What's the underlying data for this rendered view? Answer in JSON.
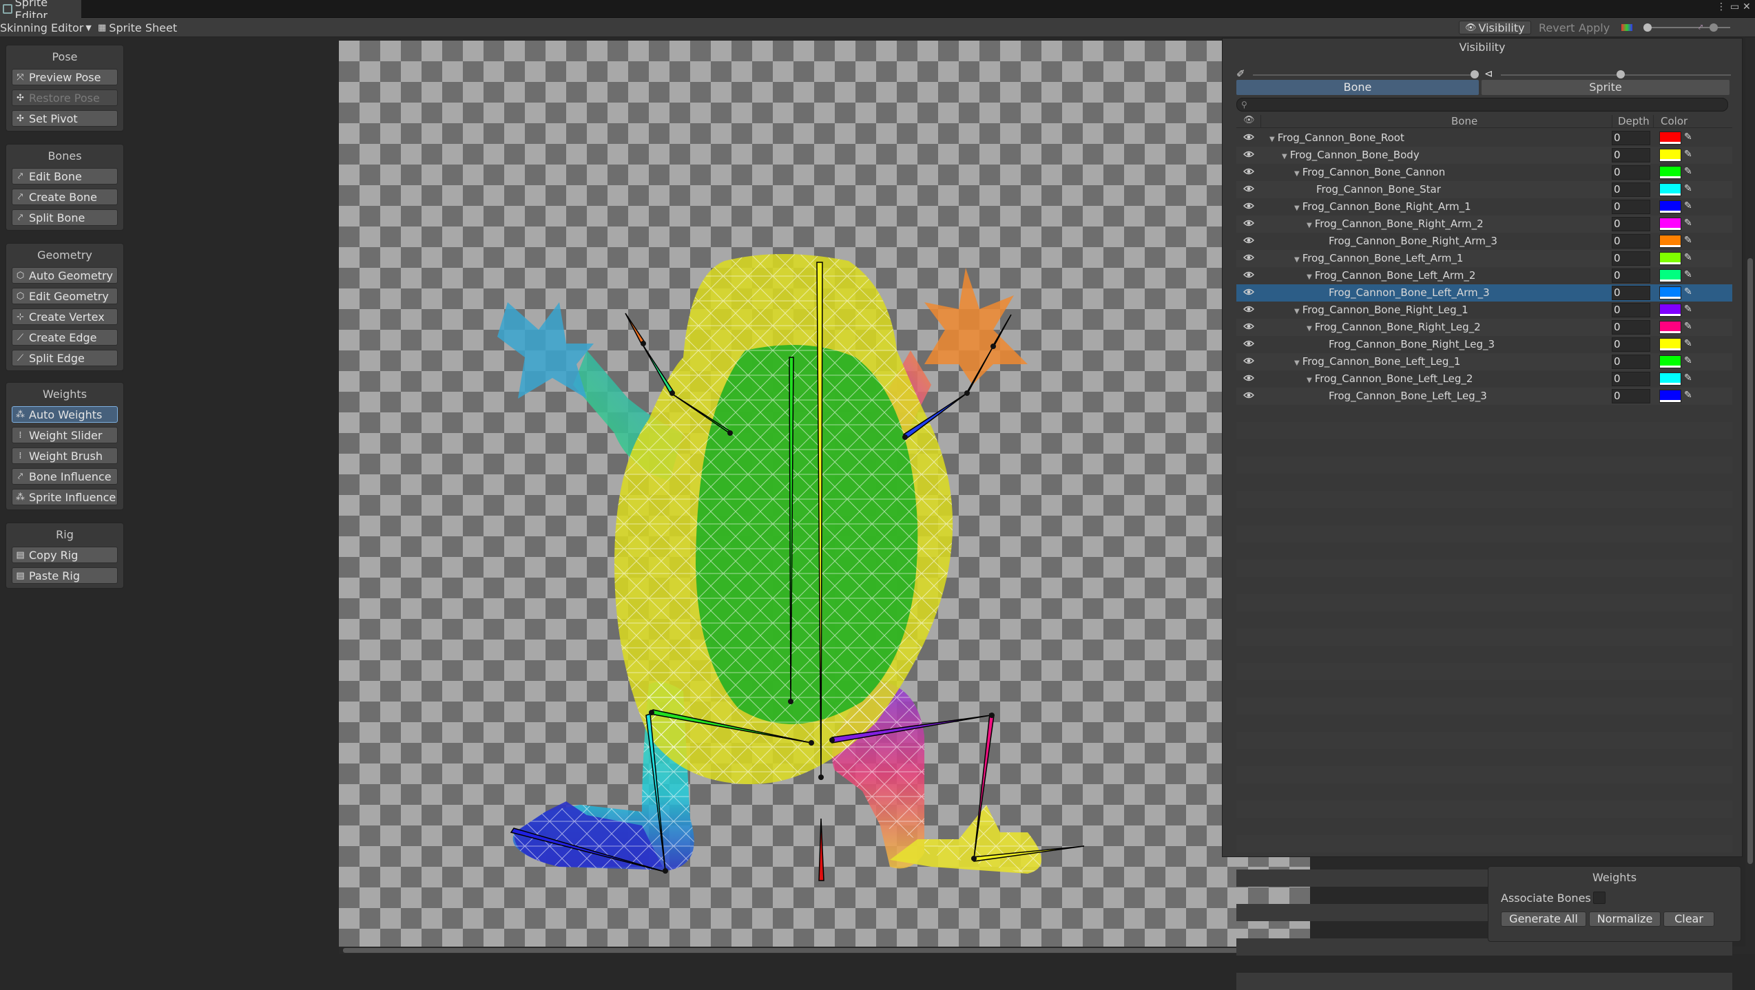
{
  "window": {
    "title": "Sprite Editor"
  },
  "toolbar": {
    "mode_dropdown": "Skinning Editor",
    "sprite_sheet": "Sprite Sheet",
    "visibility": "Visibility",
    "revert": "Revert",
    "apply": "Apply"
  },
  "left_panel": {
    "groups": [
      {
        "title": "Pose",
        "tools": [
          {
            "label": "Preview Pose",
            "state": "normal"
          },
          {
            "label": "Restore Pose",
            "state": "disabled"
          },
          {
            "label": "Set Pivot",
            "state": "normal"
          }
        ]
      },
      {
        "title": "Bones",
        "tools": [
          {
            "label": "Edit Bone",
            "state": "normal"
          },
          {
            "label": "Create Bone",
            "state": "normal"
          },
          {
            "label": "Split Bone",
            "state": "normal"
          }
        ]
      },
      {
        "title": "Geometry",
        "tools": [
          {
            "label": "Auto Geometry",
            "state": "normal"
          },
          {
            "label": "Edit Geometry",
            "state": "normal"
          },
          {
            "label": "Create Vertex",
            "state": "normal"
          },
          {
            "label": "Create Edge",
            "state": "normal"
          },
          {
            "label": "Split Edge",
            "state": "normal"
          }
        ]
      },
      {
        "title": "Weights",
        "tools": [
          {
            "label": "Auto Weights",
            "state": "active"
          },
          {
            "label": "Weight Slider",
            "state": "normal"
          },
          {
            "label": "Weight Brush",
            "state": "normal"
          },
          {
            "label": "Bone Influence",
            "state": "normal"
          },
          {
            "label": "Sprite Influence",
            "state": "normal"
          }
        ]
      },
      {
        "title": "Rig",
        "tools": [
          {
            "label": "Copy Rig",
            "state": "normal"
          },
          {
            "label": "Paste Rig",
            "state": "normal"
          }
        ]
      }
    ]
  },
  "visibility_panel": {
    "title": "Visibility",
    "tabs": {
      "bone": "Bone",
      "sprite": "Sprite"
    },
    "columns": {
      "bone": "Bone",
      "depth": "Depth",
      "color": "Color"
    },
    "bones": [
      {
        "name": "Frog_Cannon_Bone_Root",
        "indent": 0,
        "arrow": true,
        "depth": "0",
        "color": "#ff0000",
        "selected": false
      },
      {
        "name": "Frog_Cannon_Bone_Body",
        "indent": 1,
        "arrow": true,
        "depth": "0",
        "color": "#ffff00",
        "selected": false
      },
      {
        "name": "Frog_Cannon_Bone_Cannon",
        "indent": 2,
        "arrow": true,
        "depth": "0",
        "color": "#00ff00",
        "selected": false
      },
      {
        "name": "Frog_Cannon_Bone_Star",
        "indent": 3,
        "arrow": false,
        "depth": "0",
        "color": "#00ffff",
        "selected": false
      },
      {
        "name": "Frog_Cannon_Bone_Right_Arm_1",
        "indent": 2,
        "arrow": true,
        "depth": "0",
        "color": "#0000ff",
        "selected": false
      },
      {
        "name": "Frog_Cannon_Bone_Right_Arm_2",
        "indent": 3,
        "arrow": true,
        "depth": "0",
        "color": "#ff00ff",
        "selected": false
      },
      {
        "name": "Frog_Cannon_Bone_Right_Arm_3",
        "indent": 4,
        "arrow": false,
        "depth": "0",
        "color": "#ff8000",
        "selected": false
      },
      {
        "name": "Frog_Cannon_Bone_Left_Arm_1",
        "indent": 2,
        "arrow": true,
        "depth": "0",
        "color": "#80ff00",
        "selected": false
      },
      {
        "name": "Frog_Cannon_Bone_Left_Arm_2",
        "indent": 3,
        "arrow": true,
        "depth": "0",
        "color": "#00ff80",
        "selected": false
      },
      {
        "name": "Frog_Cannon_Bone_Left_Arm_3",
        "indent": 4,
        "arrow": false,
        "depth": "0",
        "color": "#0080ff",
        "selected": true
      },
      {
        "name": "Frog_Cannon_Bone_Right_Leg_1",
        "indent": 2,
        "arrow": true,
        "depth": "0",
        "color": "#8000ff",
        "selected": false
      },
      {
        "name": "Frog_Cannon_Bone_Right_Leg_2",
        "indent": 3,
        "arrow": true,
        "depth": "0",
        "color": "#ff0080",
        "selected": false
      },
      {
        "name": "Frog_Cannon_Bone_Right_Leg_3",
        "indent": 4,
        "arrow": false,
        "depth": "0",
        "color": "#ffff00",
        "selected": false
      },
      {
        "name": "Frog_Cannon_Bone_Left_Leg_1",
        "indent": 2,
        "arrow": true,
        "depth": "0",
        "color": "#00ff00",
        "selected": false
      },
      {
        "name": "Frog_Cannon_Bone_Left_Leg_2",
        "indent": 3,
        "arrow": true,
        "depth": "0",
        "color": "#00ffff",
        "selected": false
      },
      {
        "name": "Frog_Cannon_Bone_Left_Leg_3",
        "indent": 4,
        "arrow": false,
        "depth": "0",
        "color": "#0000ff",
        "selected": false
      }
    ]
  },
  "weights_panel": {
    "title": "Weights",
    "associate_bones": "Associate Bones",
    "generate_all": "Generate All",
    "normalize": "Normalize",
    "clear": "Clear"
  }
}
